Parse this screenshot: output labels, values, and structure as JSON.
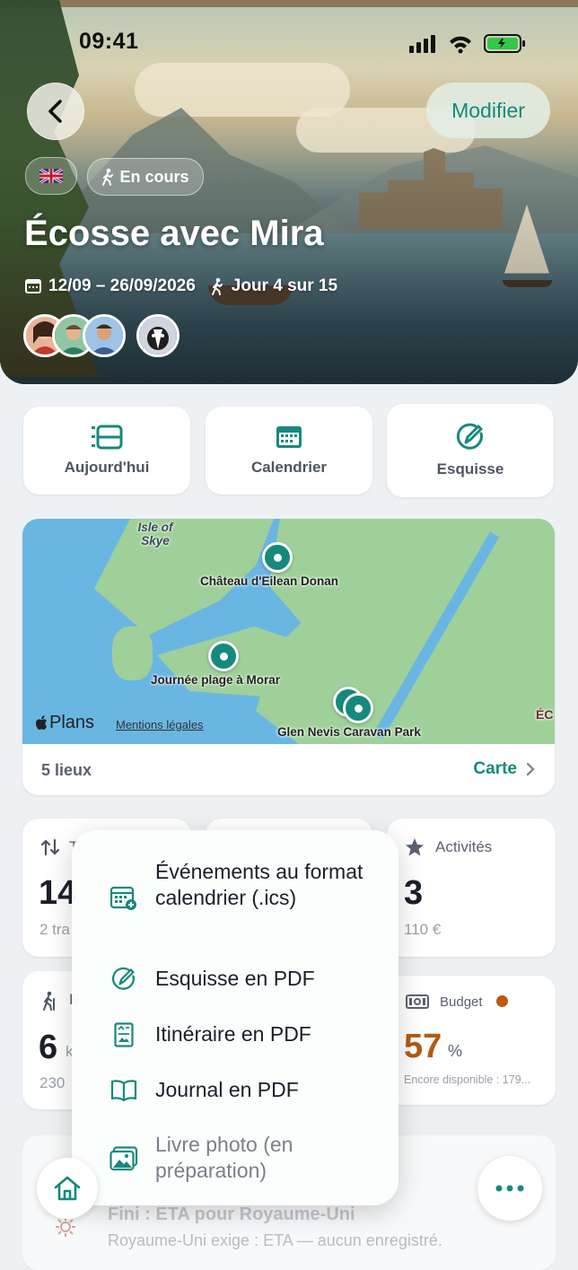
{
  "status_bar": {
    "time": "09:41"
  },
  "hero": {
    "edit_label": "Modifier",
    "flag": "UK",
    "status_chip": "En cours",
    "title": "Écosse avec Mira",
    "dates": "12/09 – 26/09/2026",
    "day_progress": "Jour 4 sur 15"
  },
  "quick_actions": [
    {
      "label": "Aujourd'hui",
      "icon": "list-timeline-icon"
    },
    {
      "label": "Calendrier",
      "icon": "calendar-icon"
    },
    {
      "label": "Esquisse",
      "icon": "sketch-pencil-icon"
    }
  ],
  "map": {
    "labels": {
      "isle": "Isle of Skye",
      "castle": "Château d'Eilean Donan",
      "beach": "Journée plage à Morar",
      "camp": "Glen Nevis Caravan Park",
      "region_cut": "ÉC"
    },
    "apple_maps": "Plans",
    "legal": "Mentions légales",
    "places_count": "5 lieux",
    "open_label": "Carte"
  },
  "stats": {
    "transport": {
      "title": "Tr",
      "value": "14",
      "sub": "2 tra"
    },
    "activities": {
      "title": "Activités",
      "value": "3",
      "sub": "110 €"
    },
    "hikes": {
      "title": "R",
      "value": "6",
      "unit": "k",
      "sub": "230"
    },
    "budget": {
      "title": "Budget",
      "value": "57",
      "unit": "%",
      "sub": "Encore disponible : 179...",
      "accent": "#b35a12"
    }
  },
  "export_menu": [
    {
      "label": "Événements au format calendrier (.ics)",
      "icon": "calendar-add-icon",
      "enabled": true
    },
    {
      "label": "Esquisse en PDF",
      "icon": "sketch-pencil-icon",
      "enabled": true
    },
    {
      "label": "Itinéraire en PDF",
      "icon": "itinerary-doc-icon",
      "enabled": true
    },
    {
      "label": "Journal en PDF",
      "icon": "book-icon",
      "enabled": true
    },
    {
      "label": "Livre photo (en préparation)",
      "icon": "photo-album-icon",
      "enabled": false
    }
  ],
  "bottom": {
    "alert_title": "Fini : ETA pour Royaume-Uni",
    "alert_sub": "Royaume-Uni exige : ETA — aucun enregistré."
  },
  "colors": {
    "accent": "#158a7c",
    "text": "#1b1f2a",
    "muted": "#5a6170"
  }
}
